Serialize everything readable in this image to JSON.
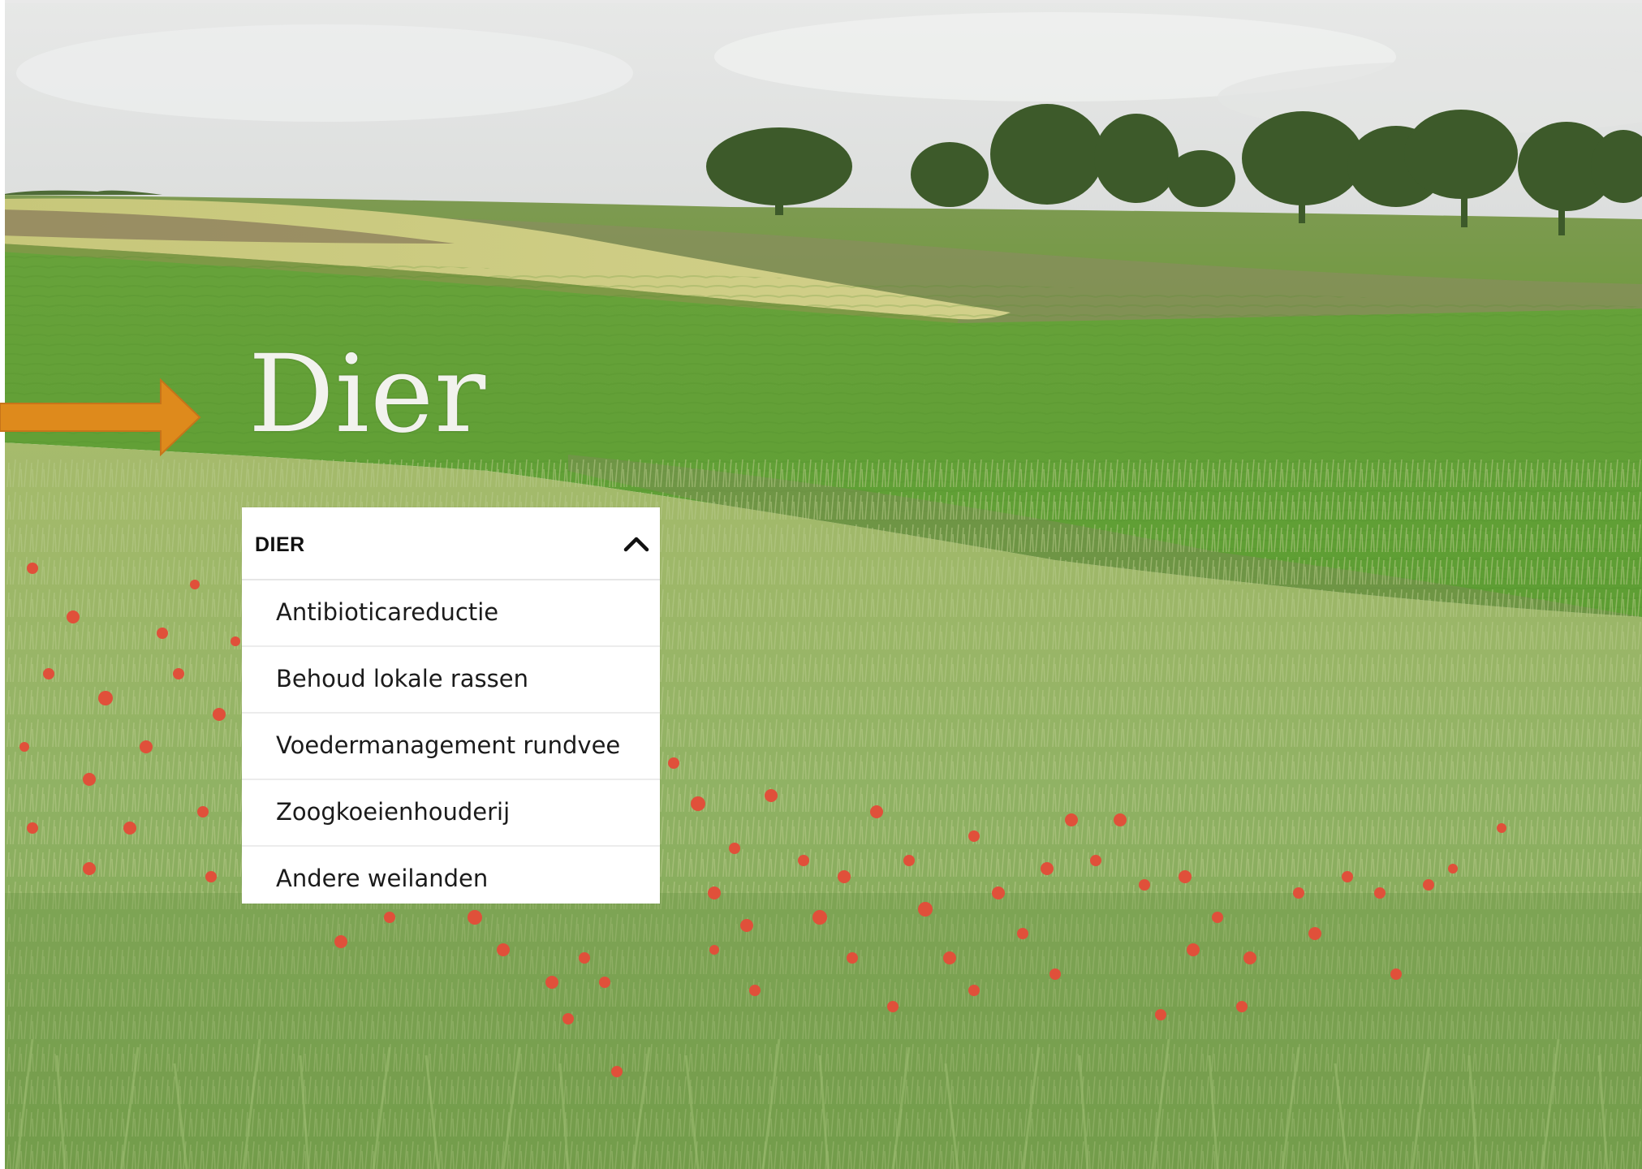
{
  "slide": {
    "title": "Dier"
  },
  "menu": {
    "header_label": "DIER",
    "items": [
      {
        "label": "Antibioticareductie"
      },
      {
        "label": "Behoud lokale rassen"
      },
      {
        "label": "Voedermanagement rundvee"
      },
      {
        "label": "Zoogkoeienhouderij"
      },
      {
        "label": "Andere weilanden"
      }
    ]
  },
  "icons": {
    "arrow": "arrow-right-icon",
    "collapse": "chevron-up-icon"
  },
  "colors": {
    "arrow": "#de8a1c",
    "title": "#f2f2ee",
    "menu_background": "#ffffff",
    "menu_text": "#111111"
  }
}
